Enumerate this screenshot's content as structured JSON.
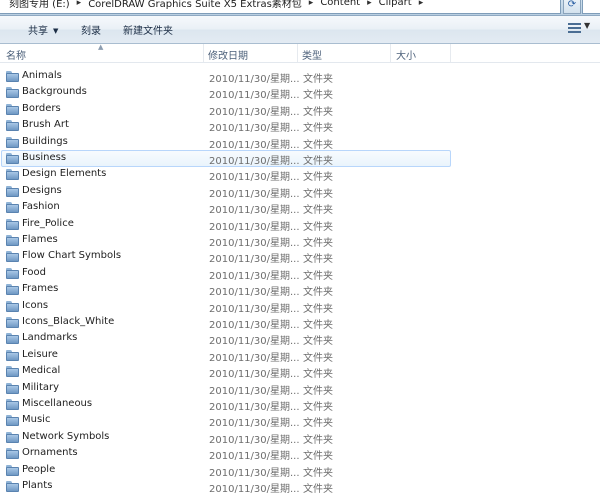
{
  "address": {
    "crumbs": [
      "刻图专用 (E:)",
      "CorelDRAW Graphics Suite X5 Extras素材包",
      "Content",
      "Clipart"
    ]
  },
  "toolbar": {
    "share_label": "共享",
    "burn_label": "刻录",
    "new_folder_label": "新建文件夹"
  },
  "columns": {
    "name": "名称",
    "date": "修改日期",
    "type": "类型",
    "size": "大小"
  },
  "files": [
    {
      "name": "Animals",
      "date": "2010/11/30/星期...",
      "type": "文件夹"
    },
    {
      "name": "Backgrounds",
      "date": "2010/11/30/星期...",
      "type": "文件夹"
    },
    {
      "name": "Borders",
      "date": "2010/11/30/星期...",
      "type": "文件夹"
    },
    {
      "name": "Brush Art",
      "date": "2010/11/30/星期...",
      "type": "文件夹"
    },
    {
      "name": "Buildings",
      "date": "2010/11/30/星期...",
      "type": "文件夹"
    },
    {
      "name": "Business",
      "date": "2010/11/30/星期...",
      "type": "文件夹",
      "hover": true
    },
    {
      "name": "Design Elements",
      "date": "2010/11/30/星期...",
      "type": "文件夹"
    },
    {
      "name": "Designs",
      "date": "2010/11/30/星期...",
      "type": "文件夹"
    },
    {
      "name": "Fashion",
      "date": "2010/11/30/星期...",
      "type": "文件夹"
    },
    {
      "name": "Fire_Police",
      "date": "2010/11/30/星期...",
      "type": "文件夹"
    },
    {
      "name": "Flames",
      "date": "2010/11/30/星期...",
      "type": "文件夹"
    },
    {
      "name": "Flow Chart Symbols",
      "date": "2010/11/30/星期...",
      "type": "文件夹"
    },
    {
      "name": "Food",
      "date": "2010/11/30/星期...",
      "type": "文件夹"
    },
    {
      "name": "Frames",
      "date": "2010/11/30/星期...",
      "type": "文件夹"
    },
    {
      "name": "Icons",
      "date": "2010/11/30/星期...",
      "type": "文件夹"
    },
    {
      "name": "Icons_Black_White",
      "date": "2010/11/30/星期...",
      "type": "文件夹"
    },
    {
      "name": "Landmarks",
      "date": "2010/11/30/星期...",
      "type": "文件夹"
    },
    {
      "name": "Leisure",
      "date": "2010/11/30/星期...",
      "type": "文件夹"
    },
    {
      "name": "Medical",
      "date": "2010/11/30/星期...",
      "type": "文件夹"
    },
    {
      "name": "Military",
      "date": "2010/11/30/星期...",
      "type": "文件夹"
    },
    {
      "name": "Miscellaneous",
      "date": "2010/11/30/星期...",
      "type": "文件夹"
    },
    {
      "name": "Music",
      "date": "2010/11/30/星期...",
      "type": "文件夹"
    },
    {
      "name": "Network Symbols",
      "date": "2010/11/30/星期...",
      "type": "文件夹"
    },
    {
      "name": "Ornaments",
      "date": "2010/11/30/星期...",
      "type": "文件夹"
    },
    {
      "name": "People",
      "date": "2010/11/30/星期...",
      "type": "文件夹"
    },
    {
      "name": "Plants",
      "date": "2010/11/30/星期...",
      "type": "文件夹"
    }
  ],
  "icons": {
    "folder": "folder-icon",
    "refresh": "refresh-icon",
    "view": "view-options-icon",
    "sort": "sort-ascending-icon"
  },
  "colors": {
    "hover_border": "#b8d6fb",
    "folder": "#6f98c4",
    "toolbar_text": "#1b2d45"
  }
}
